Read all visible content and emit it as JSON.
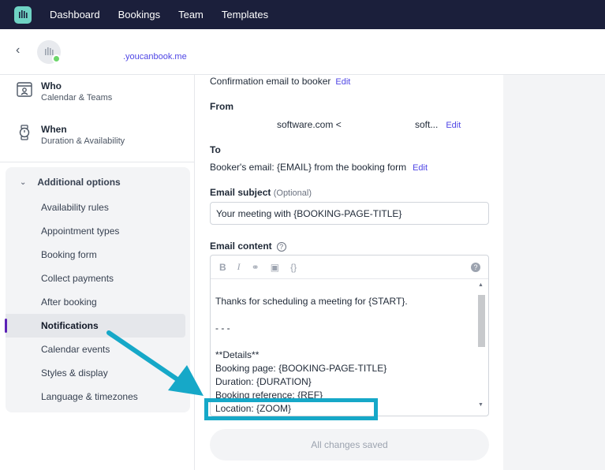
{
  "nav": {
    "items": [
      "Dashboard",
      "Bookings",
      "Team",
      "Templates"
    ]
  },
  "header": {
    "booking_url": ".youcanbook.me"
  },
  "sidebar": {
    "who": {
      "title": "Who",
      "sub": "Calendar & Teams"
    },
    "when": {
      "title": "When",
      "sub": "Duration & Availability"
    },
    "options_title": "Additional options",
    "items": [
      "Availability rules",
      "Appointment types",
      "Booking form",
      "Collect payments",
      "After booking",
      "Notifications",
      "Calendar events",
      "Styles & display",
      "Language & timezones"
    ],
    "active_index": 5
  },
  "email": {
    "confirmation_text": "Confirmation email to booker",
    "edit": "Edit",
    "from_label": "From",
    "from_value_a": "software.com <",
    "from_value_b": "soft...",
    "to_label": "To",
    "to_value": "Booker's email: {EMAIL} from the booking form",
    "subject_label": "Email subject",
    "subject_optional": "(Optional)",
    "subject_value": "Your meeting with {BOOKING-PAGE-TITLE}",
    "content_label": "Email content",
    "toolbar": [
      "B",
      "I",
      "⚭",
      "▣",
      "{}"
    ],
    "content_lines": [
      "Thanks for scheduling a meeting for {START}.",
      "",
      "- - -",
      "",
      "**Details**",
      "Booking page: {BOOKING-PAGE-TITLE}",
      "Duration: {DURATION}",
      "Booking reference: {REF}",
      "Location: {ZOOM}"
    ],
    "save_label": "All changes saved"
  },
  "colors": {
    "nav_bg": "#1b1f3b",
    "accent": "#4f46e5",
    "annotation": "#16a8c8",
    "active_bar": "#5b21b6"
  }
}
